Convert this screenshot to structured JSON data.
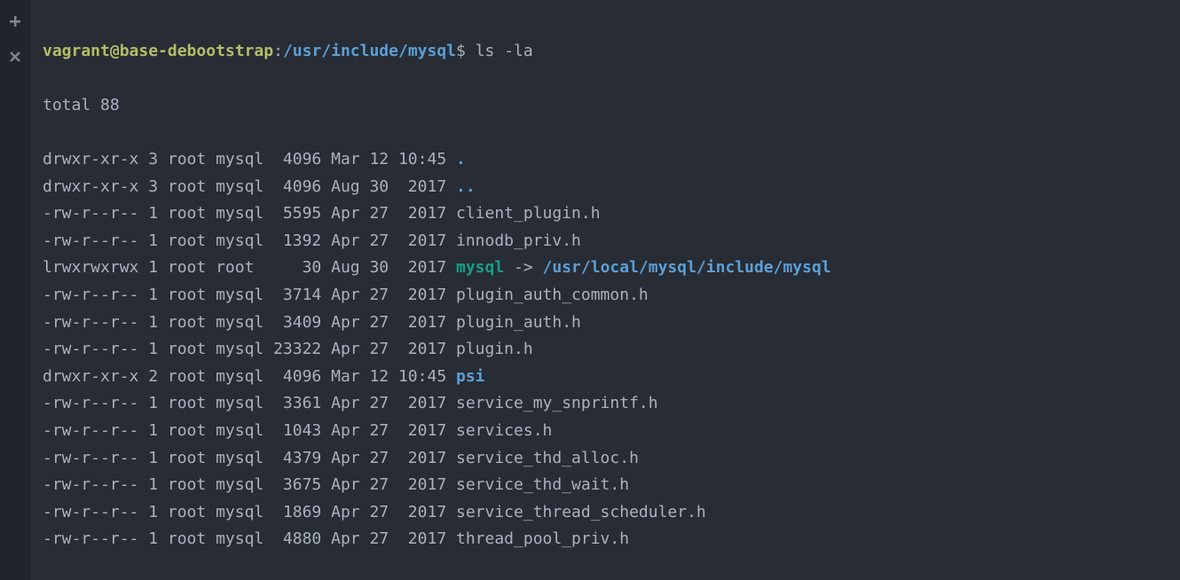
{
  "prompt": {
    "user_host": "vagrant@base-debootstrap",
    "path": "/usr/include/mysql",
    "command": "ls -la"
  },
  "total_line": "total 88",
  "entries": [
    {
      "perms": "drwxr-xr-x",
      "links": "3",
      "owner": "root",
      "group": "mysql",
      "size": " 4096",
      "date": "Mar 12 10:45",
      "name": ".",
      "type": "dir"
    },
    {
      "perms": "drwxr-xr-x",
      "links": "3",
      "owner": "root",
      "group": "mysql",
      "size": " 4096",
      "date": "Aug 30  2017",
      "name": "..",
      "type": "dir"
    },
    {
      "perms": "-rw-r--r--",
      "links": "1",
      "owner": "root",
      "group": "mysql",
      "size": " 5595",
      "date": "Apr 27  2017",
      "name": "client_plugin.h",
      "type": "file"
    },
    {
      "perms": "-rw-r--r--",
      "links": "1",
      "owner": "root",
      "group": "mysql",
      "size": " 1392",
      "date": "Apr 27  2017",
      "name": "innodb_priv.h",
      "type": "file"
    },
    {
      "perms": "lrwxrwxrwx",
      "links": "1",
      "owner": "root",
      "group": "root ",
      "size": "   30",
      "date": "Aug 30  2017",
      "name": "mysql",
      "type": "link",
      "arrow": " -> ",
      "target": "/usr/local/mysql/include/mysql"
    },
    {
      "perms": "-rw-r--r--",
      "links": "1",
      "owner": "root",
      "group": "mysql",
      "size": " 3714",
      "date": "Apr 27  2017",
      "name": "plugin_auth_common.h",
      "type": "file"
    },
    {
      "perms": "-rw-r--r--",
      "links": "1",
      "owner": "root",
      "group": "mysql",
      "size": " 3409",
      "date": "Apr 27  2017",
      "name": "plugin_auth.h",
      "type": "file"
    },
    {
      "perms": "-rw-r--r--",
      "links": "1",
      "owner": "root",
      "group": "mysql",
      "size": "23322",
      "date": "Apr 27  2017",
      "name": "plugin.h",
      "type": "file"
    },
    {
      "perms": "drwxr-xr-x",
      "links": "2",
      "owner": "root",
      "group": "mysql",
      "size": " 4096",
      "date": "Mar 12 10:45",
      "name": "psi",
      "type": "dir"
    },
    {
      "perms": "-rw-r--r--",
      "links": "1",
      "owner": "root",
      "group": "mysql",
      "size": " 3361",
      "date": "Apr 27  2017",
      "name": "service_my_snprintf.h",
      "type": "file"
    },
    {
      "perms": "-rw-r--r--",
      "links": "1",
      "owner": "root",
      "group": "mysql",
      "size": " 1043",
      "date": "Apr 27  2017",
      "name": "services.h",
      "type": "file"
    },
    {
      "perms": "-rw-r--r--",
      "links": "1",
      "owner": "root",
      "group": "mysql",
      "size": " 4379",
      "date": "Apr 27  2017",
      "name": "service_thd_alloc.h",
      "type": "file"
    },
    {
      "perms": "-rw-r--r--",
      "links": "1",
      "owner": "root",
      "group": "mysql",
      "size": " 3675",
      "date": "Apr 27  2017",
      "name": "service_thd_wait.h",
      "type": "file"
    },
    {
      "perms": "-rw-r--r--",
      "links": "1",
      "owner": "root",
      "group": "mysql",
      "size": " 1869",
      "date": "Apr 27  2017",
      "name": "service_thread_scheduler.h",
      "type": "file"
    },
    {
      "perms": "-rw-r--r--",
      "links": "1",
      "owner": "root",
      "group": "mysql",
      "size": " 4880",
      "date": "Apr 27  2017",
      "name": "thread_pool_priv.h",
      "type": "file"
    }
  ]
}
